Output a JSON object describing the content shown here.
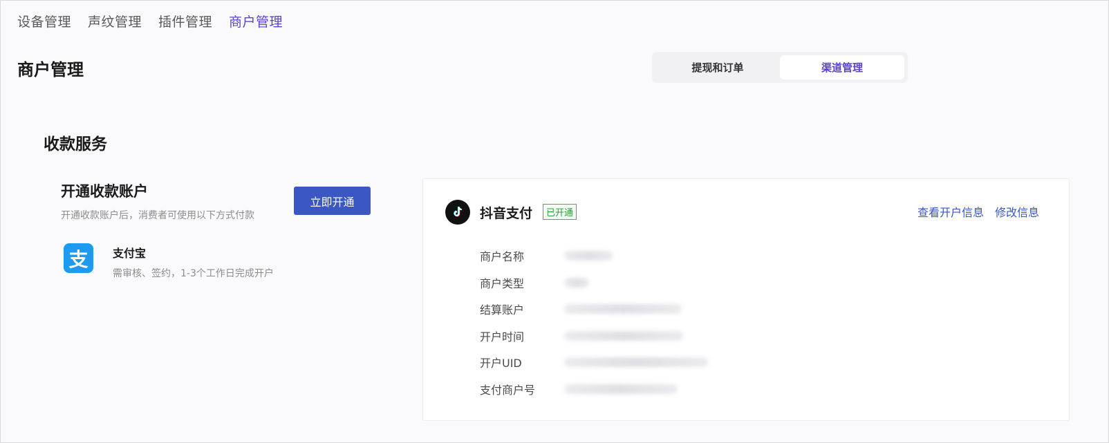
{
  "topnav": {
    "items": [
      {
        "label": "设备管理",
        "active": false
      },
      {
        "label": "声纹管理",
        "active": false
      },
      {
        "label": "插件管理",
        "active": false
      },
      {
        "label": "商户管理",
        "active": true
      }
    ]
  },
  "page": {
    "title": "商户管理"
  },
  "segmented": {
    "tabs": [
      {
        "label": "提现和订单",
        "active": false
      },
      {
        "label": "渠道管理",
        "active": true
      }
    ]
  },
  "section": {
    "title": "收款服务"
  },
  "open_account": {
    "title": "开通收款账户",
    "description": "开通收款账户后，消费者可使用以下方式付款",
    "button_label": "立即开通"
  },
  "alipay": {
    "icon": "alipay-icon",
    "icon_glyph": "支",
    "name": "支付宝",
    "description": "需审核、签约，1-3个工作日完成开户"
  },
  "douyin_card": {
    "icon": "douyin-icon",
    "name": "抖音支付",
    "status": "已开通",
    "links": {
      "view": "查看开户信息",
      "edit": "修改信息"
    },
    "fields": [
      {
        "label": "商户名称"
      },
      {
        "label": "商户类型"
      },
      {
        "label": "结算账户"
      },
      {
        "label": "开户时间"
      },
      {
        "label": "开户UID"
      },
      {
        "label": "支付商户号"
      }
    ]
  },
  "colors": {
    "accent": "#5b3fd6",
    "primary_button": "#3a57c4",
    "link": "#3a57c4",
    "success": "#3bb54a",
    "alipay_blue": "#1c9bf0"
  }
}
